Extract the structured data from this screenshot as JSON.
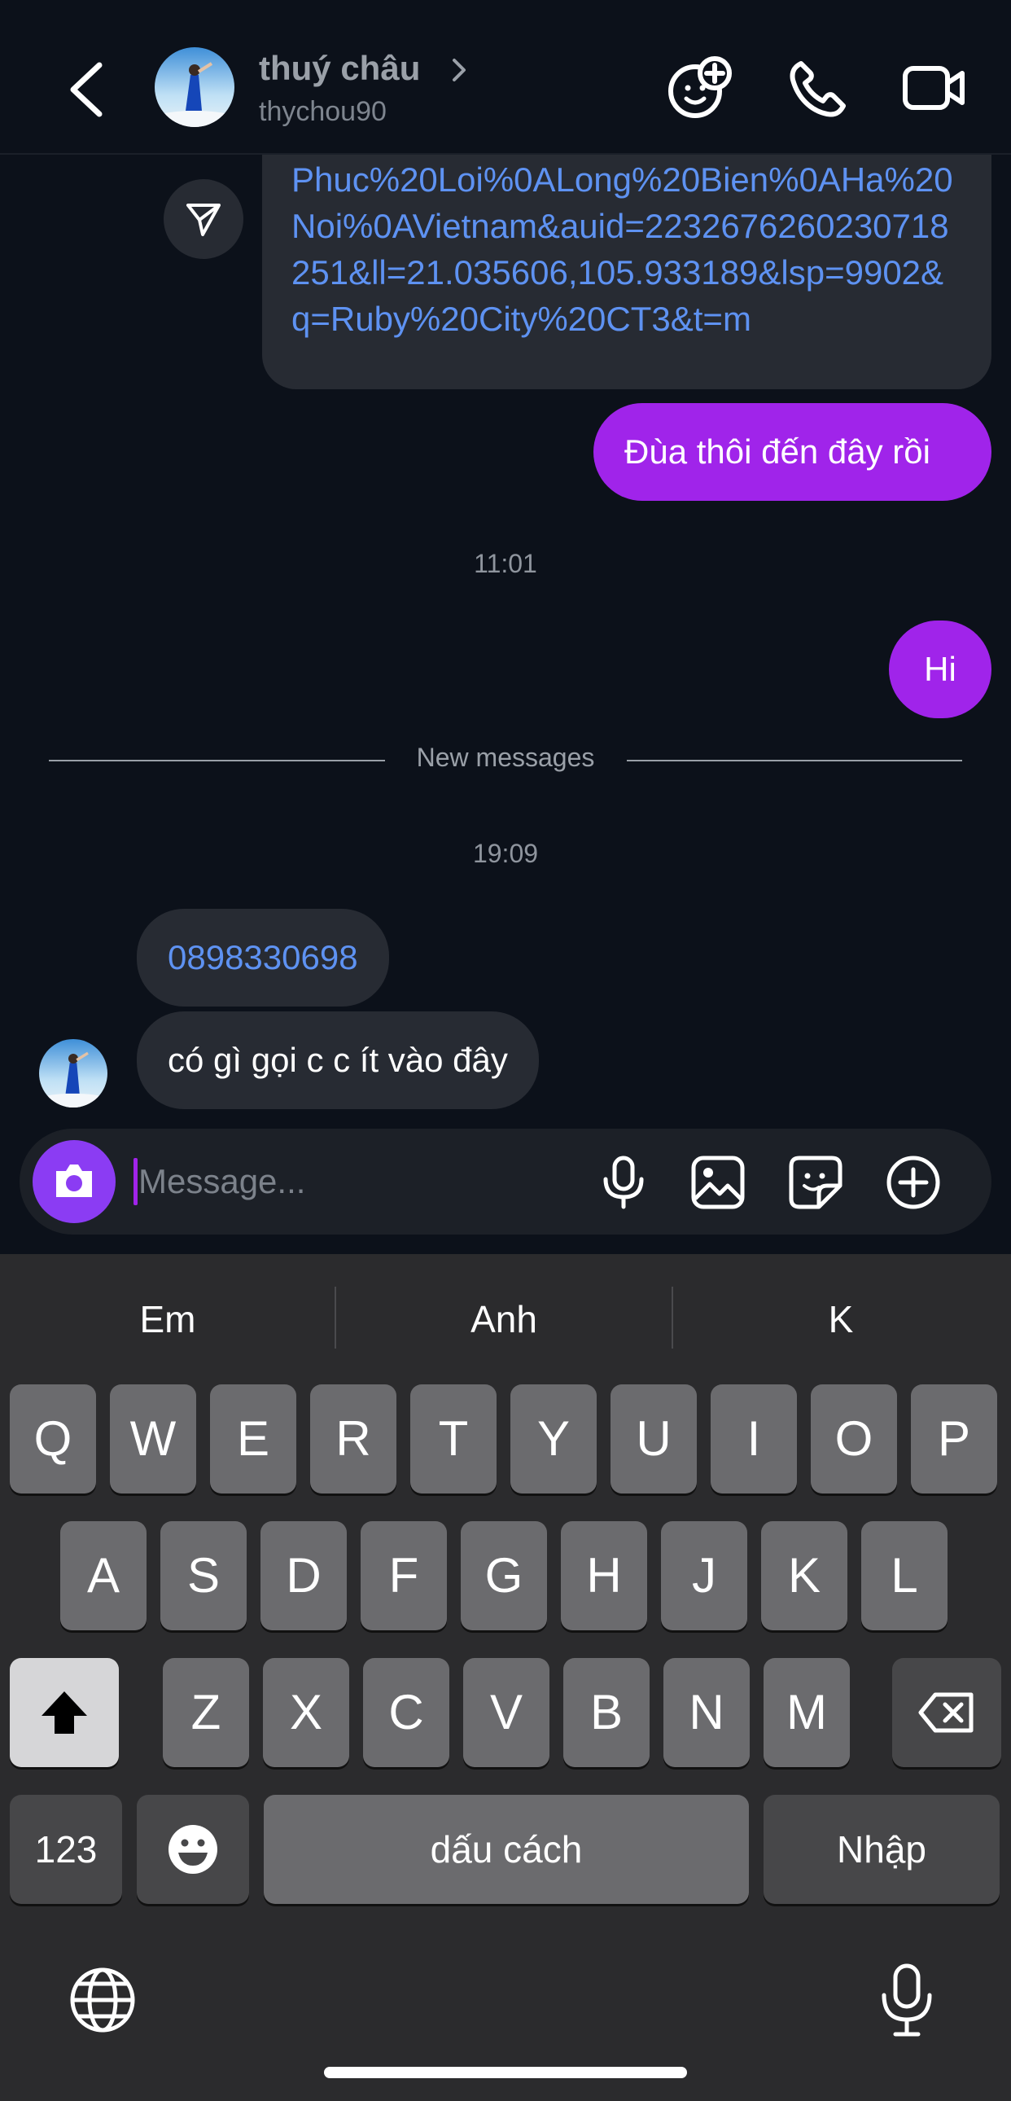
{
  "header": {
    "name": "thuý châu",
    "username": "thychou90"
  },
  "chat": {
    "link_message": "Phuc%20Loi%0ALong%20Bien%0AHa%20Noi%0AVietnam&auid=2232676260230718251&ll=21.035606,105.933189&lsp=9902&q=Ruby%20City%20CT3&t=m",
    "outgoing_1": "Đùa thôi đến đây rồi",
    "time_1": "11:01",
    "outgoing_2": "Hi",
    "new_messages_label": "New messages",
    "time_2": "19:09",
    "incoming_phone": "0898330698",
    "incoming_text": "có gì gọi c c ít vào đây"
  },
  "composer": {
    "placeholder": "Message..."
  },
  "keyboard": {
    "suggestions": [
      "Em",
      "Anh",
      "K"
    ],
    "row1": [
      "Q",
      "W",
      "E",
      "R",
      "T",
      "Y",
      "U",
      "I",
      "O",
      "P"
    ],
    "row2": [
      "A",
      "S",
      "D",
      "F",
      "G",
      "H",
      "J",
      "K",
      "L"
    ],
    "row3": [
      "Z",
      "X",
      "C",
      "V",
      "B",
      "N",
      "M"
    ],
    "numbers_label": "123",
    "space_label": "dấu cách",
    "return_label": "Nhập"
  }
}
